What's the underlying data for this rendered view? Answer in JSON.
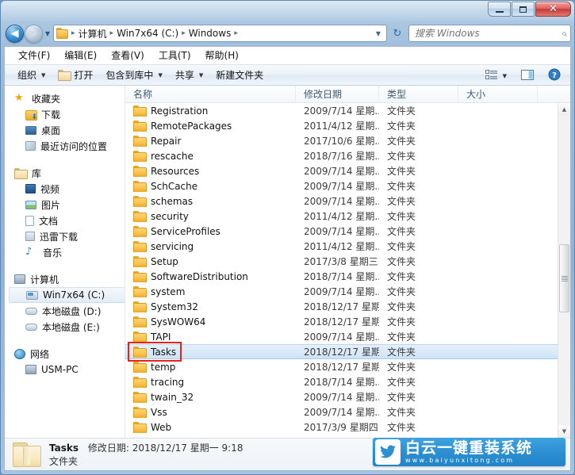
{
  "window": {
    "title": "",
    "caption_buttons": {
      "minimize": "—",
      "maximize": "□",
      "close": "✕"
    }
  },
  "address_bar": {
    "back_label": "◀",
    "forward_label": "▶",
    "history_caret": "▼",
    "breadcrumbs": [
      "计算机",
      "Win7x64 (C:)",
      "Windows"
    ],
    "separator": "▸",
    "dropdown_caret": "▼",
    "refresh_label": "↻"
  },
  "search": {
    "placeholder": "搜索 Windows",
    "icon": "search-icon"
  },
  "menubar": {
    "items": [
      {
        "label": "文件(F)"
      },
      {
        "label": "编辑(E)"
      },
      {
        "label": "查看(V)"
      },
      {
        "label": "工具(T)"
      },
      {
        "label": "帮助(H)"
      }
    ]
  },
  "toolbar": {
    "organize": "组织",
    "open": "打开",
    "include_in_library": "包含到库中",
    "share": "共享",
    "new_folder": "新建文件夹",
    "caret": "▼",
    "view_icon": "view-mode-icon",
    "preview_icon": "preview-pane-icon",
    "help_icon": "help-icon",
    "help_glyph": "?"
  },
  "navigation_pane": {
    "groups": [
      {
        "header": "收藏夹",
        "header_icon": "star-icon",
        "items": [
          {
            "label": "下载",
            "icon": "download-folder-icon"
          },
          {
            "label": "桌面",
            "icon": "desktop-icon"
          },
          {
            "label": "最近访问的位置",
            "icon": "recent-places-icon"
          }
        ]
      },
      {
        "header": "库",
        "header_icon": "library-icon",
        "items": [
          {
            "label": "视频",
            "icon": "video-library-icon"
          },
          {
            "label": "图片",
            "icon": "pictures-library-icon"
          },
          {
            "label": "文档",
            "icon": "documents-library-icon"
          },
          {
            "label": "迅雷下载",
            "icon": "thunder-download-icon"
          },
          {
            "label": "音乐",
            "icon": "music-library-icon"
          }
        ]
      },
      {
        "header": "计算机",
        "header_icon": "computer-icon",
        "items": [
          {
            "label": "Win7x64 (C:)",
            "icon": "system-drive-icon",
            "selected": true
          },
          {
            "label": "本地磁盘 (D:)",
            "icon": "hard-disk-icon"
          },
          {
            "label": "本地磁盘 (E:)",
            "icon": "hard-disk-icon"
          }
        ]
      },
      {
        "header": "网络",
        "header_icon": "network-icon",
        "items": [
          {
            "label": "USM-PC",
            "icon": "computer-icon"
          }
        ]
      }
    ]
  },
  "file_list": {
    "columns": [
      "名称",
      "修改日期",
      "类型",
      "大小"
    ],
    "sort_column": "名称",
    "sort_direction": "ascending",
    "rows": [
      {
        "name": "Registration",
        "date": "2009/7/14 星期...",
        "type": "文件夹",
        "size": ""
      },
      {
        "name": "RemotePackages",
        "date": "2011/4/12 星期...",
        "type": "文件夹",
        "size": ""
      },
      {
        "name": "Repair",
        "date": "2017/10/6 星期...",
        "type": "文件夹",
        "size": ""
      },
      {
        "name": "rescache",
        "date": "2018/7/16 星期...",
        "type": "文件夹",
        "size": ""
      },
      {
        "name": "Resources",
        "date": "2009/7/14 星期...",
        "type": "文件夹",
        "size": ""
      },
      {
        "name": "SchCache",
        "date": "2009/7/14 星期...",
        "type": "文件夹",
        "size": ""
      },
      {
        "name": "schemas",
        "date": "2009/7/14 星期...",
        "type": "文件夹",
        "size": ""
      },
      {
        "name": "security",
        "date": "2011/4/12 星期...",
        "type": "文件夹",
        "size": ""
      },
      {
        "name": "ServiceProfiles",
        "date": "2009/7/14 星期...",
        "type": "文件夹",
        "size": ""
      },
      {
        "name": "servicing",
        "date": "2011/4/12 星期...",
        "type": "文件夹",
        "size": ""
      },
      {
        "name": "Setup",
        "date": "2017/3/8 星期三 ...",
        "type": "文件夹",
        "size": ""
      },
      {
        "name": "SoftwareDistribution",
        "date": "2018/7/14 星期...",
        "type": "文件夹",
        "size": ""
      },
      {
        "name": "system",
        "date": "2009/7/14 星期...",
        "type": "文件夹",
        "size": ""
      },
      {
        "name": "System32",
        "date": "2018/12/17 星期...",
        "type": "文件夹",
        "size": ""
      },
      {
        "name": "SysWOW64",
        "date": "2018/12/17 星期...",
        "type": "文件夹",
        "size": ""
      },
      {
        "name": "TAPI",
        "date": "2009/7/14 星期...",
        "type": "文件夹",
        "size": ""
      },
      {
        "name": "Tasks",
        "date": "2018/12/17 星期...",
        "type": "文件夹",
        "size": "",
        "selected": true,
        "annotated": true
      },
      {
        "name": "temp",
        "date": "2018/12/17 星期...",
        "type": "文件夹",
        "size": ""
      },
      {
        "name": "tracing",
        "date": "2018/7/14 星期...",
        "type": "文件夹",
        "size": ""
      },
      {
        "name": "twain_32",
        "date": "2009/7/14 星期...",
        "type": "文件夹",
        "size": ""
      },
      {
        "name": "Vss",
        "date": "2009/7/14 星期...",
        "type": "文件夹",
        "size": ""
      },
      {
        "name": "Web",
        "date": "2017/3/9 星期四 ...",
        "type": "文件夹",
        "size": ""
      }
    ],
    "scrollbar": {
      "up_arrow": "▲",
      "down_arrow": "▼"
    }
  },
  "details_pane": {
    "name": "Tasks",
    "modified_label": "修改日期:",
    "modified_value": "2018/12/17 星期一 9:18",
    "type": "文件夹"
  },
  "watermark": {
    "title": "白云一键重装系统",
    "url": "www.baiyunxitong.com",
    "icon": "twitter-bird-icon",
    "background_color": "#2b8fd2"
  },
  "colors": {
    "selection": "#cfe3f6",
    "annotation": "#e8241a",
    "accent": "#2b8fd2"
  }
}
